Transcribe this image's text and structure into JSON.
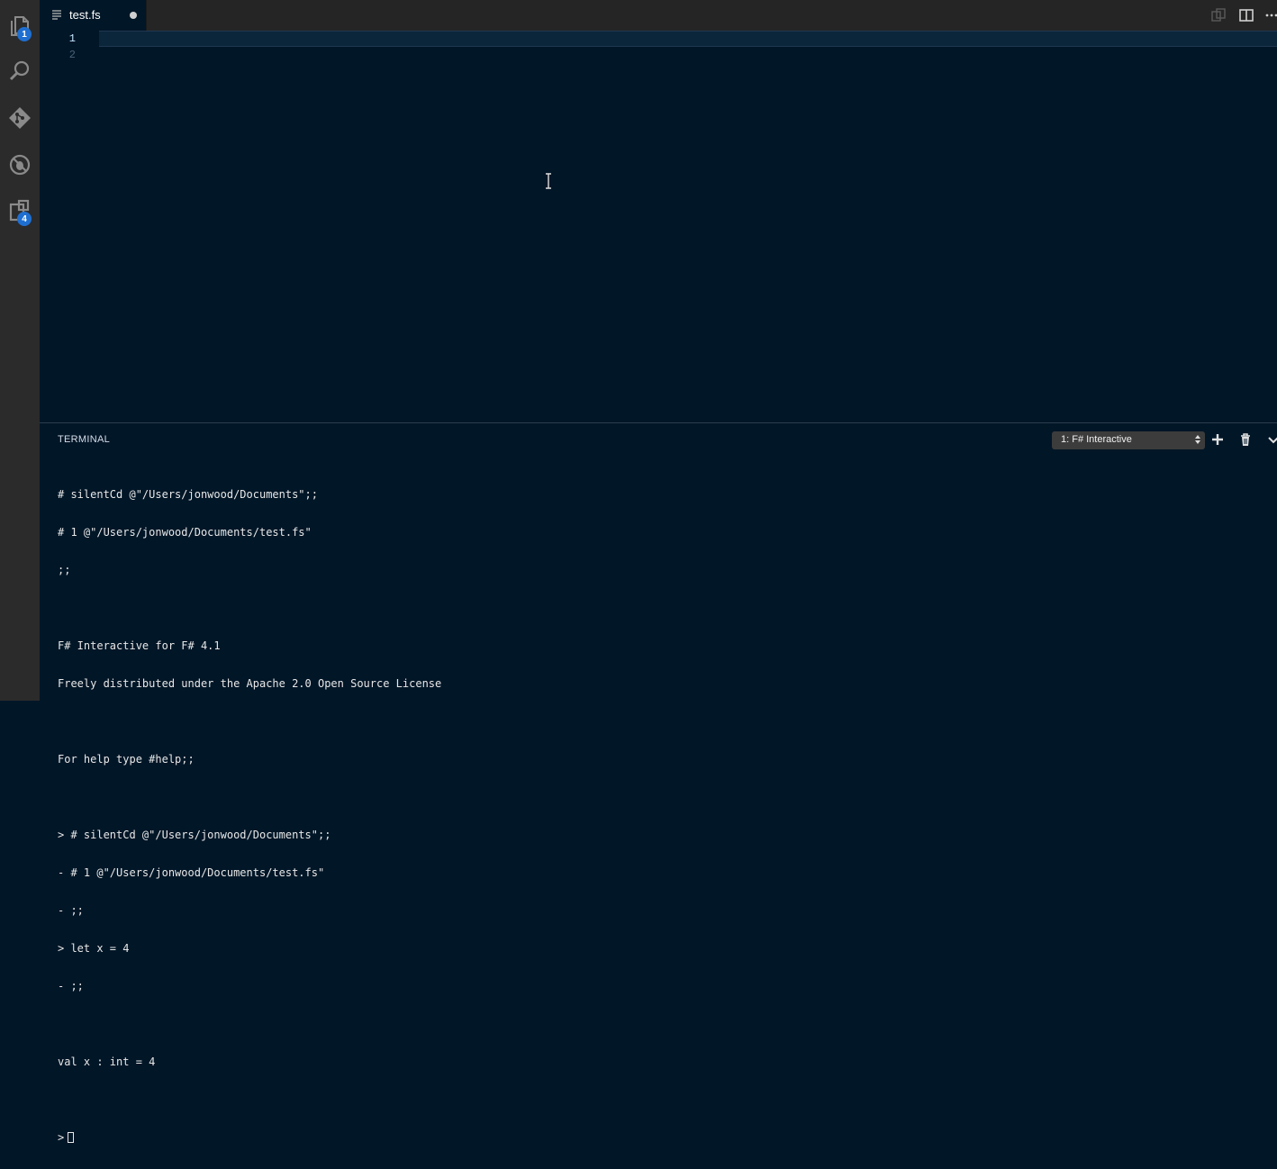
{
  "activity_bar": {
    "explorer_badge": "1",
    "extensions_badge": "4"
  },
  "editor": {
    "tab": {
      "filename": "test.fs",
      "dirty": true
    },
    "line_numbers": [
      "1",
      "2"
    ]
  },
  "panel": {
    "title": "TERMINAL",
    "terminal_select": "1: F# Interactive",
    "lines": [
      "# silentCd @\"/Users/jonwood/Documents\";;",
      "# 1 @\"/Users/jonwood/Documents/test.fs\"",
      ";;",
      "",
      "F# Interactive for F# 4.1",
      "Freely distributed under the Apache 2.0 Open Source License",
      "",
      "For help type #help;;",
      "",
      "> # silentCd @\"/Users/jonwood/Documents\";;",
      "- # 1 @\"/Users/jonwood/Documents/test.fs\"",
      "- ;;",
      "> let x = 4",
      "- ;;",
      "",
      "val x : int = 4",
      ""
    ],
    "prompt": ">"
  },
  "colors": {
    "editor_bg": "#011627",
    "activity_bar_bg": "#2b2b2b",
    "badge": "#1f6fd1",
    "current_line": "#0b253a"
  }
}
